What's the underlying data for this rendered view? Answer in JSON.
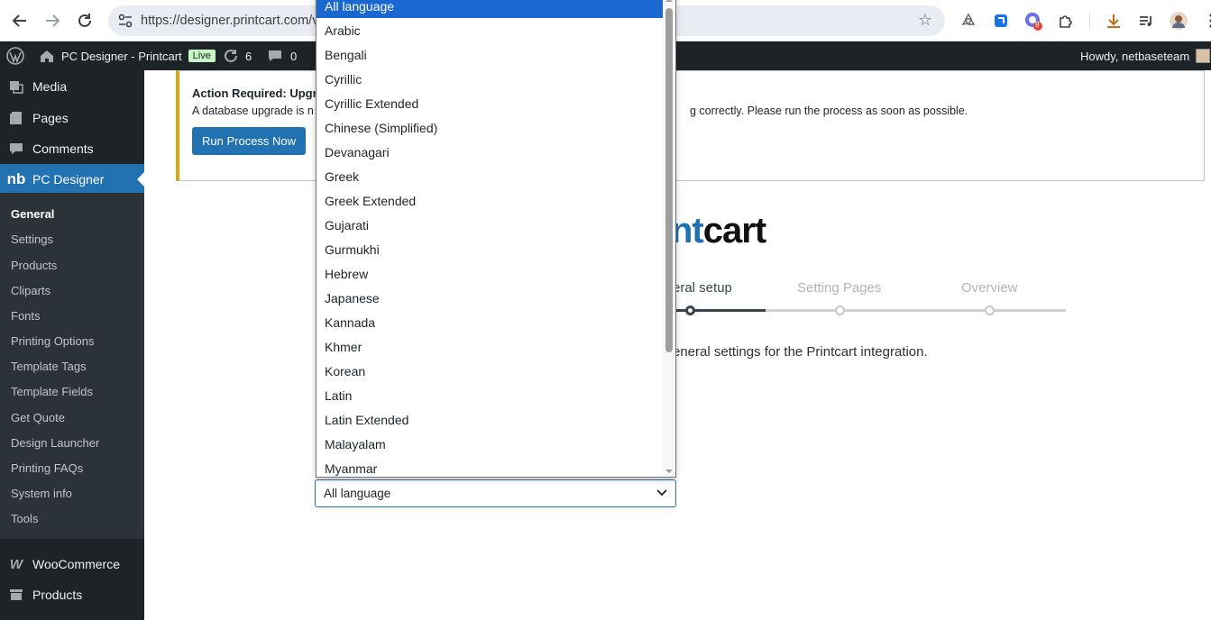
{
  "browser": {
    "url": "https://designer.printcart.com/v",
    "extension_badge": "9"
  },
  "adminbar": {
    "site_name": "PC Designer - Printcart",
    "live_badge": "Live",
    "updates_count": "6",
    "comments_count": "0",
    "greeting": "Howdy, netbaseteam"
  },
  "sidebar": {
    "top_items": [
      {
        "label": "Media",
        "icon": "media-icon"
      },
      {
        "label": "Pages",
        "icon": "pages-icon"
      },
      {
        "label": "Comments",
        "icon": "comments-icon"
      },
      {
        "label": "PC Designer",
        "icon": "nb-logo-icon"
      }
    ],
    "submenu": [
      "General",
      "Settings",
      "Products",
      "Cliparts",
      "Fonts",
      "Printing Options",
      "Template Tags",
      "Template Fields",
      "Get Quote",
      "Design Launcher",
      "Printing FAQs",
      "System info",
      "Tools"
    ],
    "bottom_items": [
      {
        "label": "WooCommerce",
        "icon": "woocommerce-icon"
      },
      {
        "label": "Products",
        "icon": "products-icon"
      }
    ]
  },
  "notice": {
    "title": "Action Required: Upgr",
    "text_left": "A database upgrade is n",
    "text_right": "g correctly. Please run the process as soon as possible.",
    "button": "Run Process Now"
  },
  "logo": {
    "partial_blue": "nt",
    "partial_dark": "cart"
  },
  "steps": {
    "labels": [
      "eral setup",
      "Setting Pages",
      "Overview"
    ],
    "current_index": 0
  },
  "description": "eneral settings for the Printcart integration.",
  "language_select": {
    "value": "All language",
    "options": [
      "All language",
      "Arabic",
      "Bengali",
      "Cyrillic",
      "Cyrillic Extended",
      "Chinese (Simplified)",
      "Devanagari",
      "Greek",
      "Greek Extended",
      "Gujarati",
      "Gurmukhi",
      "Hebrew",
      "Japanese",
      "Kannada",
      "Khmer",
      "Korean",
      "Latin",
      "Latin Extended",
      "Malayalam",
      "Myanmar"
    ],
    "selected_index": 0
  }
}
